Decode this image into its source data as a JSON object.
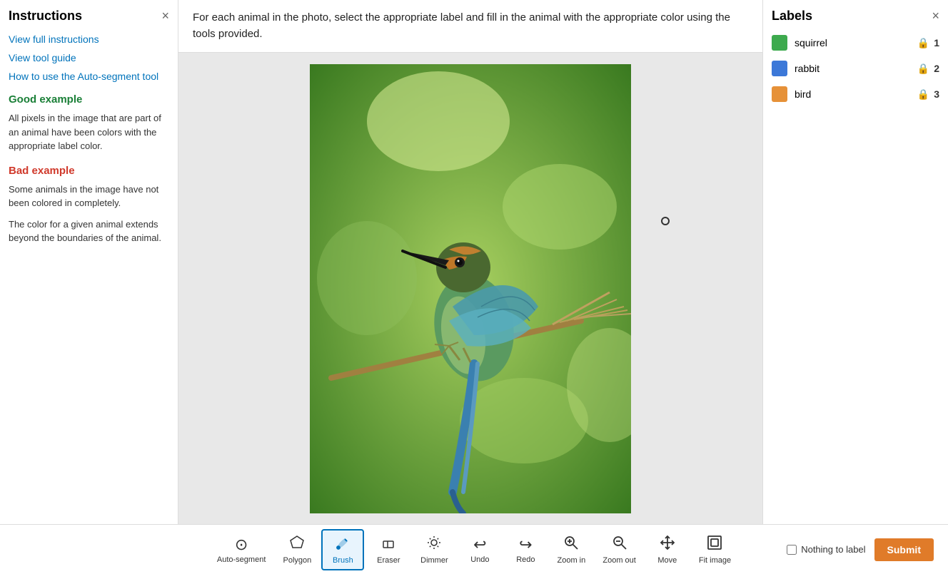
{
  "sidebar": {
    "title": "Instructions",
    "close_label": "×",
    "links": [
      {
        "id": "view-full-instructions",
        "text": "View full instructions"
      },
      {
        "id": "view-tool-guide",
        "text": "View tool guide"
      },
      {
        "id": "auto-segment-guide",
        "text": "How to use the Auto-segment tool"
      }
    ],
    "good_example": {
      "heading": "Good example",
      "text": "All pixels in the image that are part of an animal have been colors with the appropriate label color."
    },
    "bad_example": {
      "heading": "Bad example",
      "text1": "Some animals in the image have not been colored in completely.",
      "text2": "The color for a given animal extends beyond the boundaries of the animal."
    }
  },
  "instruction_bar": {
    "text": "For each animal in the photo, select the appropriate label and fill in the animal with the appropriate color using the tools provided."
  },
  "labels_panel": {
    "title": "Labels",
    "close_label": "×",
    "items": [
      {
        "name": "squirrel",
        "color": "#3daa4e",
        "number": "1"
      },
      {
        "name": "rabbit",
        "color": "#3c78d8",
        "number": "2"
      },
      {
        "name": "bird",
        "color": "#e69138",
        "number": "3"
      }
    ]
  },
  "toolbar": {
    "tools": [
      {
        "id": "auto-segment",
        "icon": "⊙",
        "label": "Auto-segment",
        "active": false
      },
      {
        "id": "polygon",
        "icon": "⬡",
        "label": "Polygon",
        "active": false
      },
      {
        "id": "brush",
        "icon": "✏",
        "label": "Brush",
        "active": true
      },
      {
        "id": "eraser",
        "icon": "◇",
        "label": "Eraser",
        "active": false
      },
      {
        "id": "dimmer",
        "icon": "☀",
        "label": "Dimmer",
        "active": false
      },
      {
        "id": "undo",
        "icon": "↩",
        "label": "Undo",
        "active": false
      },
      {
        "id": "redo",
        "icon": "↪",
        "label": "Redo",
        "active": false
      },
      {
        "id": "zoom-in",
        "icon": "⊕",
        "label": "Zoom in",
        "active": false
      },
      {
        "id": "zoom-out",
        "icon": "⊖",
        "label": "Zoom out",
        "active": false
      },
      {
        "id": "move",
        "icon": "✛",
        "label": "Move",
        "active": false
      },
      {
        "id": "fit-image",
        "icon": "⊡",
        "label": "Fit image",
        "active": false
      }
    ],
    "nothing_to_label": "Nothing to label",
    "submit_label": "Submit"
  }
}
